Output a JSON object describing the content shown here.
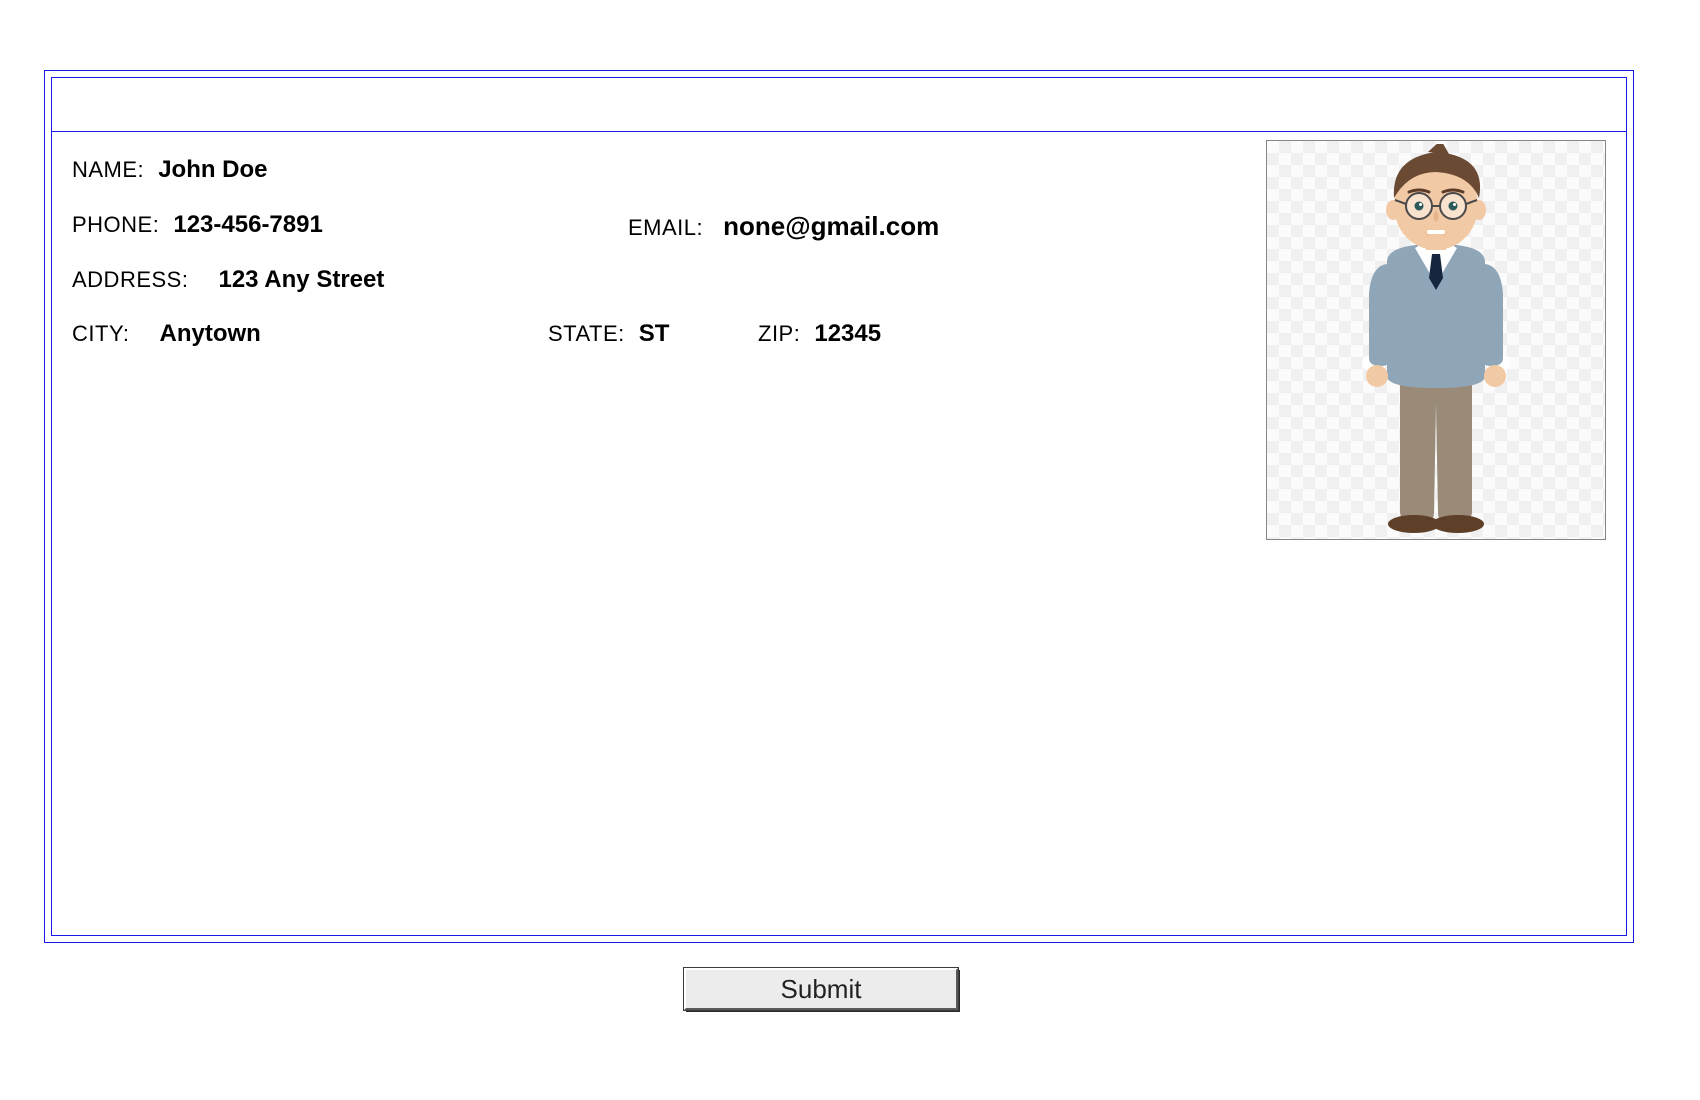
{
  "form": {
    "labels": {
      "name": "NAME:",
      "phone": "PHONE:",
      "email": "EMAIL:",
      "address": "ADDRESS:",
      "city": "CITY:",
      "state": "STATE:",
      "zip": "ZIP:"
    },
    "values": {
      "name": "John Doe",
      "phone": "123-456-7891",
      "email": "none@gmail.com",
      "address": "123 Any Street",
      "city": "Anytown",
      "state": "ST",
      "zip": "12345"
    },
    "submit_label": "Submit"
  }
}
